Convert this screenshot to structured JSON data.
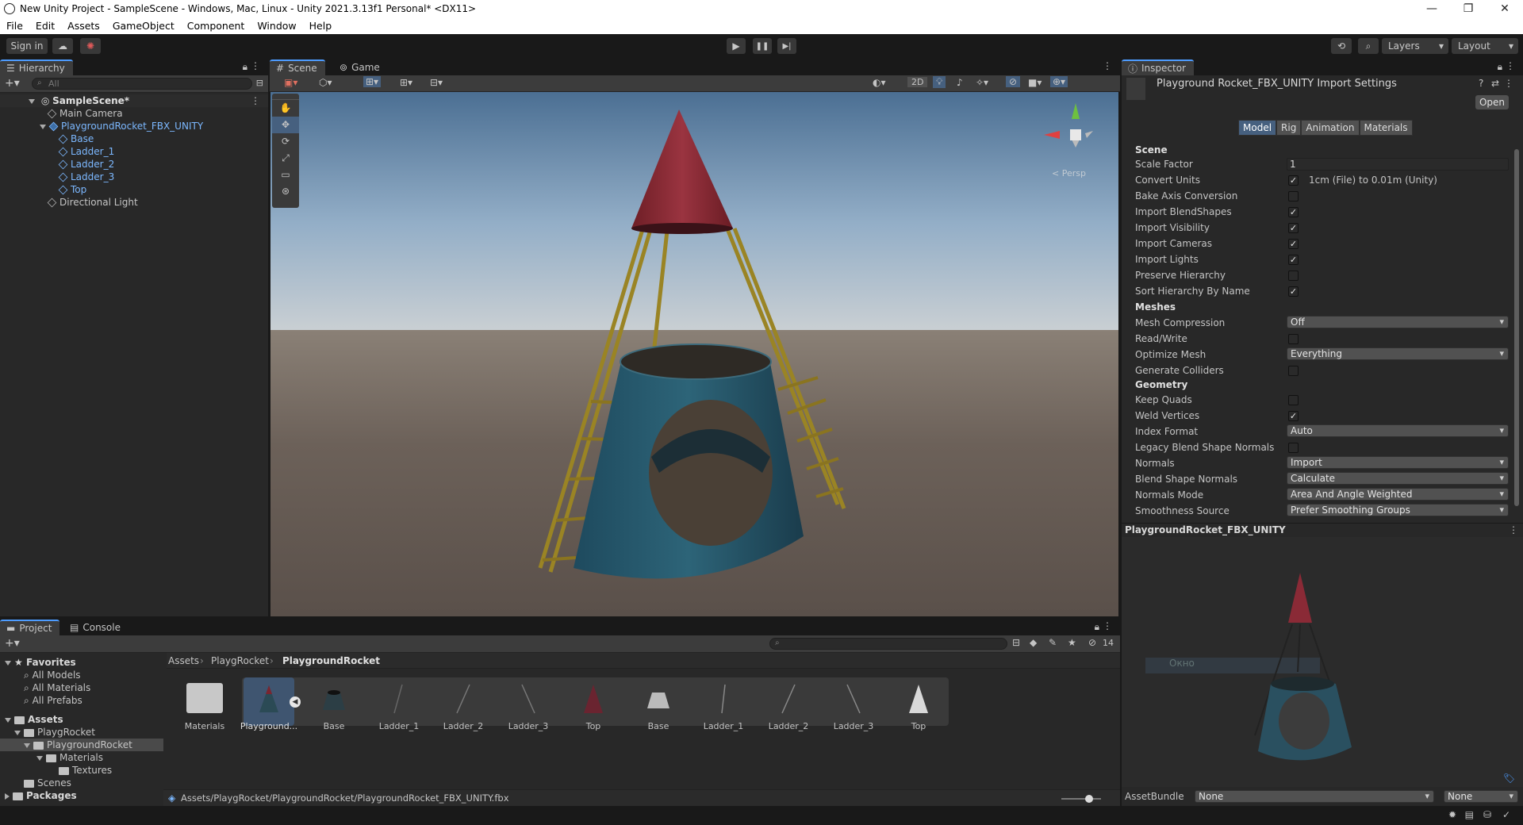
{
  "window": {
    "title": "New Unity Project - SampleScene - Windows, Mac, Linux - Unity 2021.3.13f1 Personal* <DX11>"
  },
  "menu": [
    "File",
    "Edit",
    "Assets",
    "GameObject",
    "Component",
    "Window",
    "Help"
  ],
  "toolbar": {
    "sign_in": "Sign in",
    "layers": "Layers",
    "layout": "Layout"
  },
  "hierarchy": {
    "tab": "Hierarchy",
    "search_placeholder": "All",
    "scene": "SampleScene*",
    "items": [
      {
        "label": "Main Camera"
      },
      {
        "label": "PlaygroundRocket_FBX_UNITY"
      },
      {
        "label": "Base"
      },
      {
        "label": "Ladder_1"
      },
      {
        "label": "Ladder_2"
      },
      {
        "label": "Ladder_3"
      },
      {
        "label": "Top"
      },
      {
        "label": "Directional Light"
      }
    ]
  },
  "scene_view": {
    "tabs": [
      "Scene",
      "Game"
    ],
    "btn_2d": "2D",
    "gizmo_label": "< Persp"
  },
  "inspector": {
    "tab": "Inspector",
    "title": "Playground Rocket_FBX_UNITY Import Settings",
    "open_button": "Open",
    "subtabs": [
      "Model",
      "Rig",
      "Animation",
      "Materials"
    ],
    "sections": {
      "scene": "Scene",
      "meshes": "Meshes",
      "geometry": "Geometry"
    },
    "scale_factor_label": "Scale Factor",
    "scale_factor_value": "1",
    "convert_units_label": "Convert Units",
    "convert_units_value": "1cm (File) to 0.01m (Unity)",
    "bake_axis": "Bake Axis Conversion",
    "import_blendshapes": "Import BlendShapes",
    "import_visibility": "Import Visibility",
    "import_cameras": "Import Cameras",
    "import_lights": "Import Lights",
    "preserve_hierarchy": "Preserve Hierarchy",
    "sort_hierarchy": "Sort Hierarchy By Name",
    "mesh_compression_label": "Mesh Compression",
    "mesh_compression_value": "Off",
    "read_write": "Read/Write",
    "optimize_mesh_label": "Optimize Mesh",
    "optimize_mesh_value": "Everything",
    "generate_colliders": "Generate Colliders",
    "keep_quads": "Keep Quads",
    "weld_vertices": "Weld Vertices",
    "index_format_label": "Index Format",
    "index_format_value": "Auto",
    "legacy_blend": "Legacy Blend Shape Normals",
    "normals_label": "Normals",
    "normals_value": "Import",
    "blend_normals_label": "Blend Shape Normals",
    "blend_normals_value": "Calculate",
    "normals_mode_label": "Normals Mode",
    "normals_mode_value": "Area And Angle Weighted",
    "smoothness_label": "Smoothness Source",
    "smoothness_value": "Prefer Smoothing Groups",
    "preview_title": "PlaygroundRocket_FBX_UNITY",
    "preview_ghost": "Окно",
    "assetbundle_label": "AssetBundle",
    "assetbundle_value": "None",
    "assetbundle_variant": "None"
  },
  "project": {
    "tabs": [
      "Project",
      "Console"
    ],
    "search_placeholder": "",
    "hidden_count": "14",
    "favorites": "Favorites",
    "fav_items": [
      "All Models",
      "All Materials",
      "All Prefabs"
    ],
    "assets_root": "Assets",
    "tree": [
      "PlaygRocket",
      "PlaygroundRocket",
      "Materials",
      "Textures",
      "Scenes"
    ],
    "packages": "Packages",
    "breadcrumb": [
      "Assets",
      "PlaygRocket",
      "PlaygroundRocket"
    ],
    "assets": [
      "Materials",
      "Playground...",
      "Base",
      "Ladder_1",
      "Ladder_2",
      "Ladder_3",
      "Top",
      "Base",
      "Ladder_1",
      "Ladder_2",
      "Ladder_3",
      "Top"
    ],
    "status_path": "Assets/PlaygRocket/PlaygroundRocket/PlaygroundRocket_FBX_UNITY.fbx"
  }
}
